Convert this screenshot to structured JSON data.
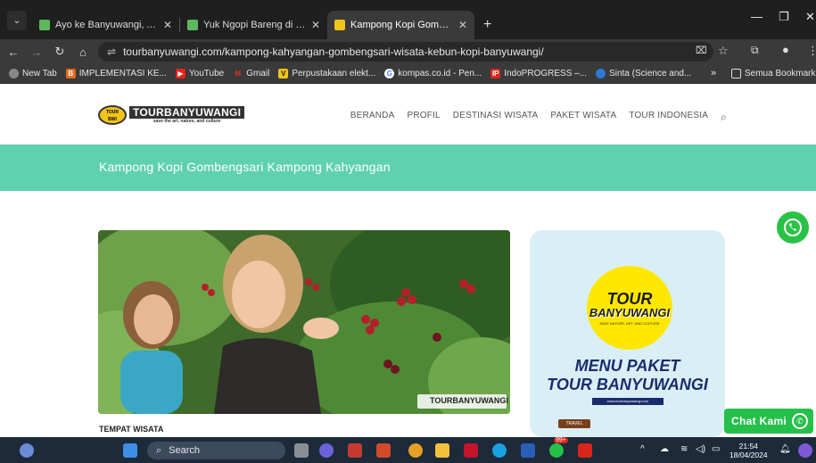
{
  "browser": {
    "tabs": [
      {
        "title": "Ayo ke Banyuwangi, Anda per",
        "active": false,
        "favicon_color": "#5cb85c"
      },
      {
        "title": "Yuk Ngopi Bareng di Pesta Ra",
        "active": false,
        "favicon_color": "#5cb85c"
      },
      {
        "title": "Kampong Kopi Gombengsari K",
        "active": true,
        "favicon_color": "#f0c419"
      }
    ],
    "url": "tourbanyuwangi.com/kampong-kahyangan-gombengsari-wisata-kebun-kopi-banyuwangi/",
    "bookmarks": [
      {
        "label": "New Tab",
        "icon_color": "#888"
      },
      {
        "label": "IMPLEMENTASI KE...",
        "icon_color": "#e66a1c",
        "icon_text": "B"
      },
      {
        "label": "YouTube",
        "icon_color": "#e62117"
      },
      {
        "label": "Gmail",
        "icon_color": "#d93025"
      },
      {
        "label": "Perpustakaan elekt...",
        "icon_color": "#f0c419",
        "icon_text": "V"
      },
      {
        "label": "kompas.co.id - Pen...",
        "icon_color": "#4285f4",
        "icon_text": "G"
      },
      {
        "label": "IndoPROGRESS –...",
        "icon_color": "#d9261c",
        "icon_text": "IP"
      },
      {
        "label": "Sinta (Science and...",
        "icon_color": "#2b7bd6"
      }
    ],
    "bookmarks_overflow": "»",
    "all_bookmarks": "Semua Bookmark"
  },
  "site": {
    "logo_name": "TOURBANYUWANGI",
    "logo_tagline": "save the art, nature, and culture",
    "nav": [
      "BERANDA",
      "PROFIL",
      "DESTINASI WISATA",
      "PAKET WISATA",
      "TOUR INDONESIA"
    ],
    "hero_title": "Kampong Kopi Gombengsari Kampong Kahyangan",
    "category": "TEMPAT WISATA",
    "photo_watermark": "TOURBANYUWANGI",
    "side_card": {
      "logo_line1": "TOUR",
      "logo_line2": "BANYUWANGI",
      "logo_line3": "SAVE NATURE, ART, AND CULTURE",
      "menu_line1": "MENU PAKET",
      "menu_line2": "TOUR BANYUWANGI",
      "website": "www.tourbanyuwangi.com",
      "sign": "TRAVEL"
    },
    "chat_label": "Chat Kami"
  },
  "taskbar": {
    "search_label": "Search",
    "time": "21:54",
    "date": "18/04/2024",
    "notification_badge": "99+"
  }
}
